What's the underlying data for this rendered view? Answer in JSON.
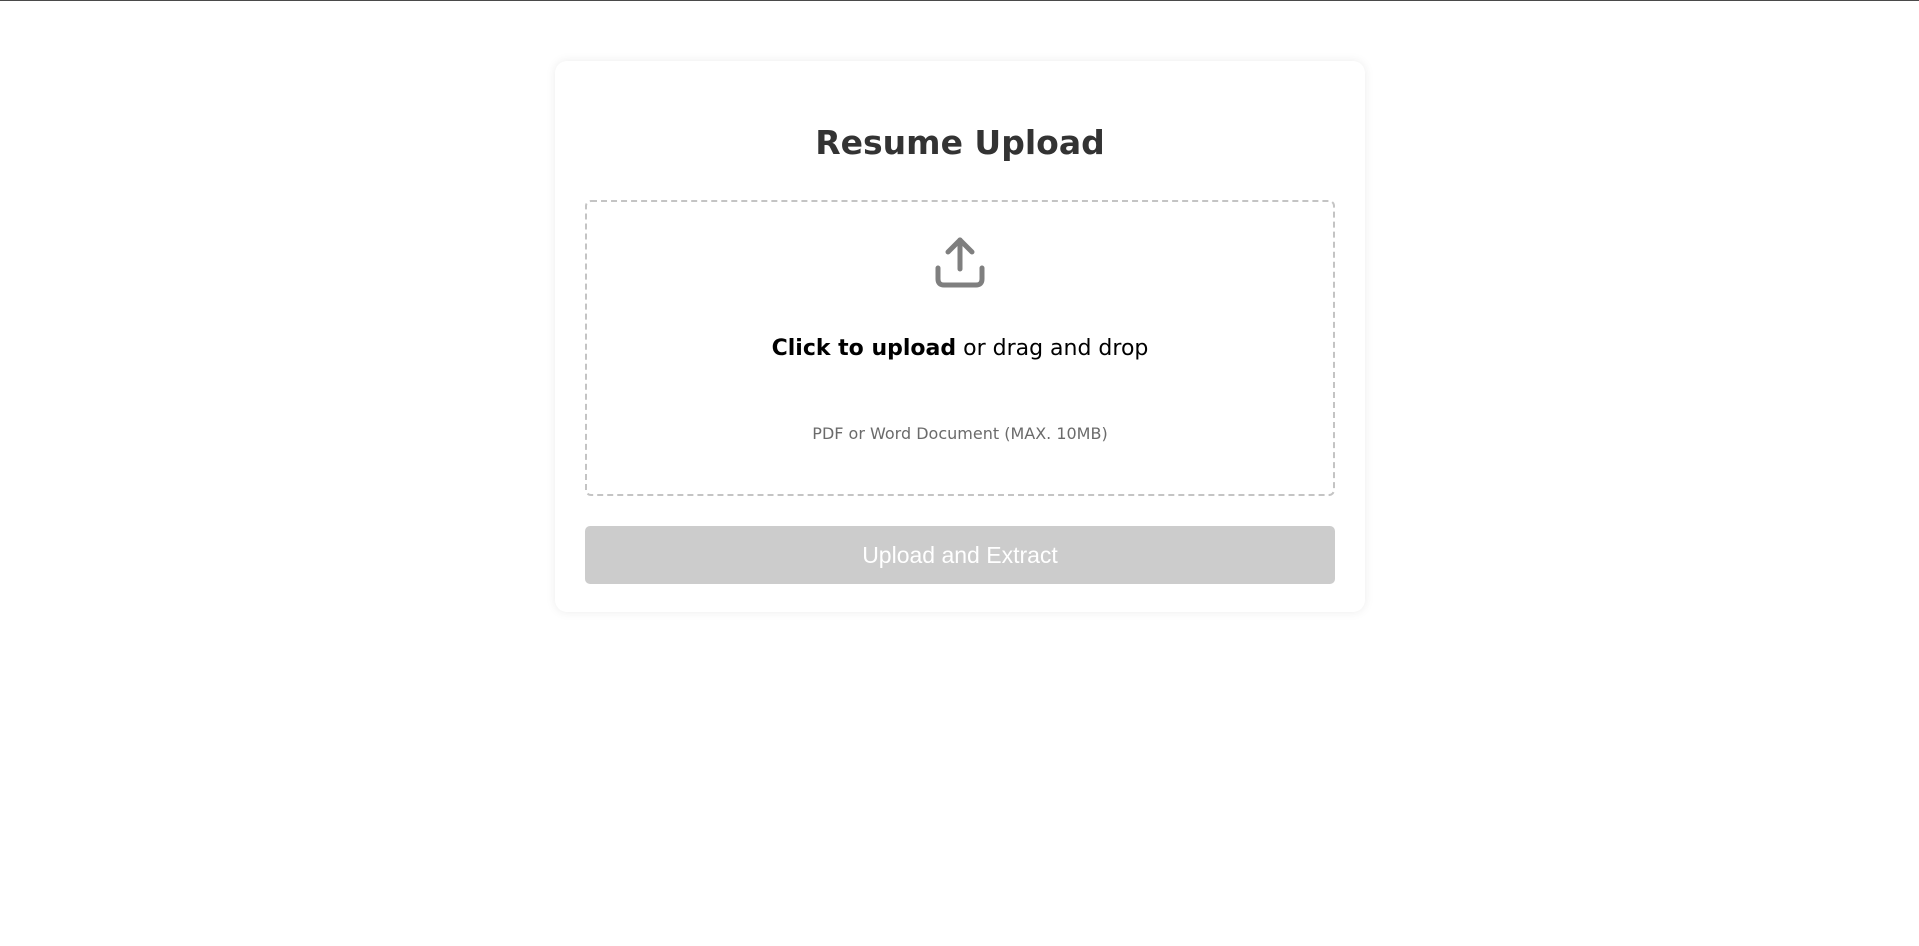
{
  "page": {
    "title": "Resume Upload"
  },
  "dropzone": {
    "icon": "upload-icon",
    "cta_strong": "Click to upload",
    "cta_rest": " or drag and drop",
    "hint": "PDF or Word Document (MAX. 10MB)"
  },
  "actions": {
    "submit_label": "Upload and Extract",
    "submit_enabled": false
  },
  "colors": {
    "title": "#333333",
    "icon": "#7f7f7f",
    "dropzone_border": "#c4c4c4",
    "button_disabled_bg": "#cccccc",
    "button_text": "#ffffff",
    "hint_text": "#6b6b6b"
  }
}
